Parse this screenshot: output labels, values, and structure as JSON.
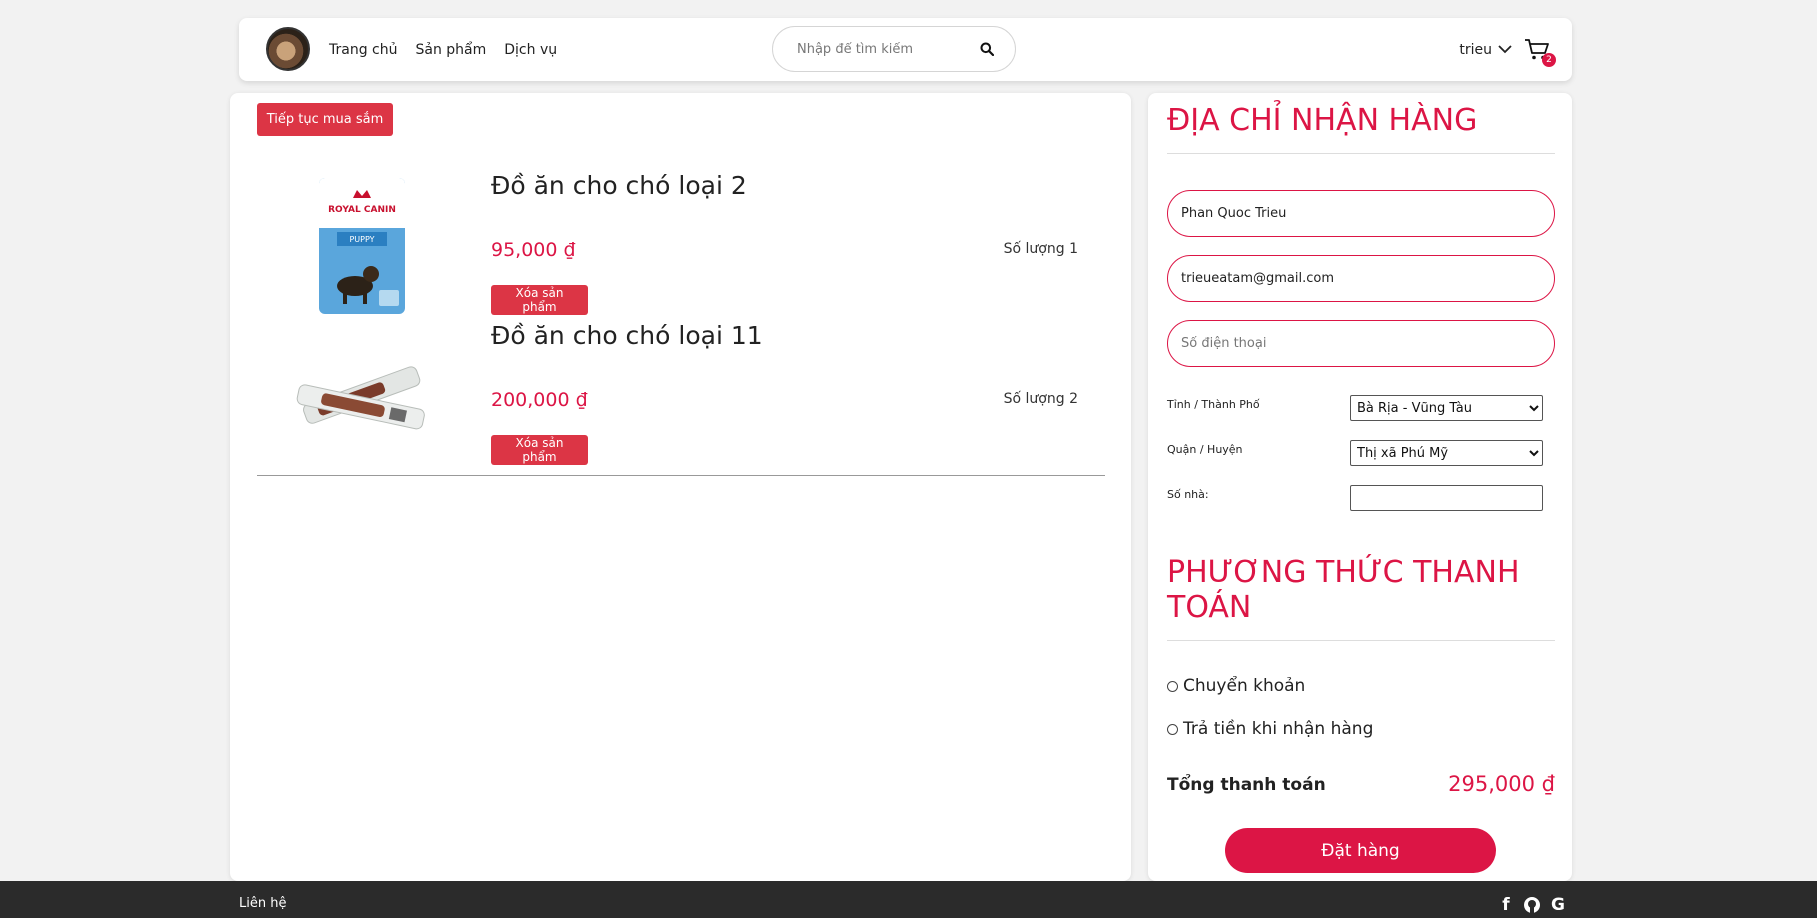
{
  "header": {
    "nav": [
      "Trang chủ",
      "Sản phẩm",
      "Dịch vụ"
    ],
    "search_placeholder": "Nhập để tìm kiếm",
    "username": "trieu",
    "cart_count": "2"
  },
  "cart": {
    "continue_label": "Tiếp tục mua sắm",
    "items": [
      {
        "name": "Đồ ăn cho chó loại 2",
        "price": "95,000  ₫",
        "quantity": "Số lượng 1",
        "remove_label": "Xóa sản phẩm",
        "image_brand": "ROYAL CANIN",
        "image_sub": "PUPPY"
      },
      {
        "name": "Đồ ăn cho chó loại 11",
        "price": "200,000  ₫",
        "quantity": "Số lượng 2",
        "remove_label": "Xóa sản phẩm"
      }
    ]
  },
  "address": {
    "title": "ĐỊA CHỈ NHẬN HÀNG",
    "name_value": "Phan Quoc Trieu",
    "email_value": "trieueatam@gmail.com",
    "phone_placeholder": "Số điện thoại",
    "province_label": "Tỉnh / Thành Phố",
    "province_value": "Bà Rịa - Vũng Tàu",
    "district_label": "Quận / Huyện",
    "district_value": "Thị xã Phú Mỹ",
    "street_label": "Số nhà:"
  },
  "payment": {
    "title": "PHƯƠNG THỨC THANH TOÁN",
    "options": [
      "Chuyển khoản",
      "Trả tiền khi nhận hàng"
    ],
    "total_label": "Tổng thanh toán",
    "total_value": "295,000  ₫",
    "order_label": "Đặt hàng"
  },
  "footer": {
    "contact_label": "Liên hệ",
    "icons": [
      "facebook-icon",
      "github-icon",
      "google-icon"
    ]
  },
  "colors": {
    "accent": "#dc1545",
    "button_red": "#dc3545",
    "footer_bg": "#2b2b2b"
  }
}
